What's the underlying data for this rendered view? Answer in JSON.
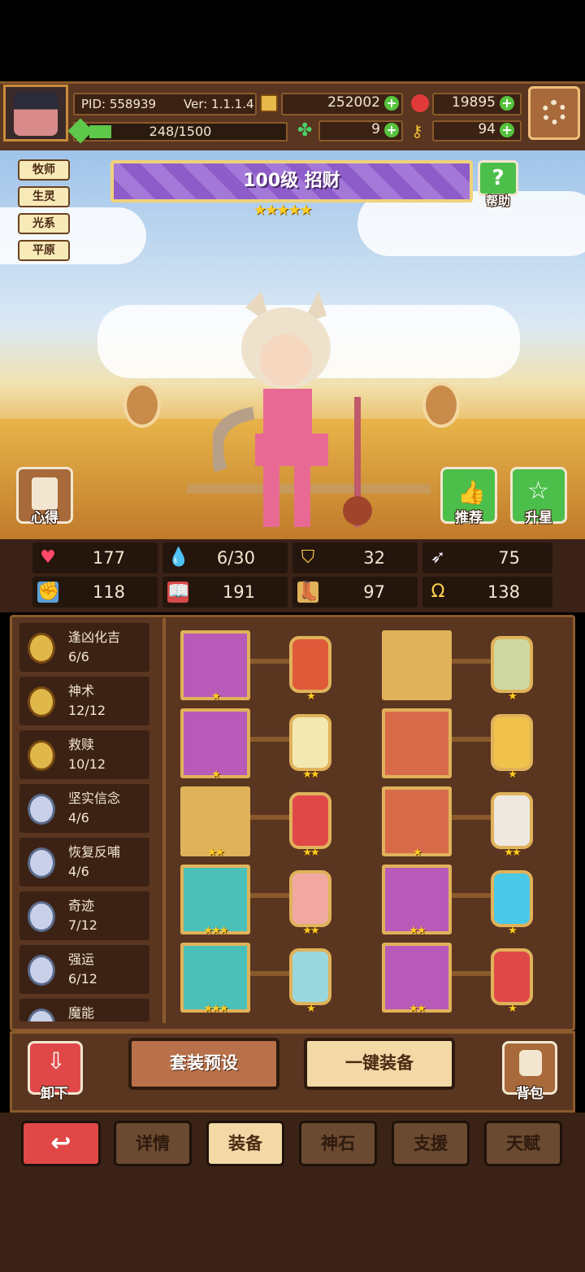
{
  "header": {
    "pid": "PID: 558939",
    "version": "Ver: 1.1.1.4",
    "gold": "252002",
    "ruby": "19895",
    "exp": "248/1500",
    "clover": "9",
    "key": "94"
  },
  "hero": {
    "tags": [
      "牧师",
      "生灵",
      "光系",
      "平原"
    ],
    "title": "100级 招财",
    "stars": "★★★★★",
    "help_label": "帮助",
    "notes_label": "心得",
    "recommend_label": "推荐",
    "upstar_label": "升星"
  },
  "stats": [
    {
      "icon": "heart-icon",
      "value": "177"
    },
    {
      "icon": "mana-drop-icon",
      "value": "6/30"
    },
    {
      "icon": "armor-shield-icon",
      "value": "32"
    },
    {
      "icon": "wing-icon",
      "value": "75"
    },
    {
      "icon": "fist-icon",
      "value": "118"
    },
    {
      "icon": "spellbook-icon",
      "value": "191"
    },
    {
      "icon": "boots-icon",
      "value": "97"
    },
    {
      "icon": "horseshoe-icon",
      "value": "138"
    }
  ],
  "skills": [
    {
      "name": "逢凶化吉",
      "count": "6/6"
    },
    {
      "name": "神术",
      "count": "12/12"
    },
    {
      "name": "救赎",
      "count": "10/12"
    },
    {
      "name": "坚实信念",
      "count": "4/6"
    },
    {
      "name": "恢复反哺",
      "count": "4/6"
    },
    {
      "name": "奇迹",
      "count": "7/12"
    },
    {
      "name": "强运",
      "count": "6/12"
    },
    {
      "name": "魔能",
      "count": ""
    }
  ],
  "equipment": [
    {
      "item": "mace",
      "item_stars": "★",
      "gem": "red-tablet",
      "gem_stars": "★"
    },
    {
      "item": "crown",
      "item_stars": "★",
      "gem": "jade-coin",
      "gem_stars": "★"
    },
    {
      "item": "chestplate",
      "item_stars": "★",
      "gem": "sun-coin",
      "gem_stars": "★★"
    },
    {
      "item": "helmet",
      "item_stars": "★",
      "gem": "sun-coin",
      "gem_stars": "★"
    },
    {
      "item": "necklace",
      "item_stars": "★★",
      "gem": "ruby-gem",
      "gem_stars": "★★"
    },
    {
      "item": "scroll",
      "item_stars": "★",
      "gem": "white-gem",
      "gem_stars": "★★"
    },
    {
      "item": "medal",
      "item_stars": "★★★",
      "gem": "pig-gem",
      "gem_stars": "★★"
    },
    {
      "item": "ring",
      "item_stars": "★★",
      "gem": "aqua-gem",
      "gem_stars": "★"
    },
    {
      "item": "urn",
      "item_stars": "★★★",
      "gem": "ghost-gem",
      "gem_stars": "★"
    },
    {
      "item": "gauntlet",
      "item_stars": "★★",
      "gem": "red-gem",
      "gem_stars": "★"
    }
  ],
  "actions": {
    "unequip": "卸下",
    "preset": "套装预设",
    "equip_all": "一键装备",
    "bag": "背包"
  },
  "tabs": [
    "详情",
    "装备",
    "神石",
    "支援",
    "天赋"
  ],
  "colors": {
    "gold_plus": "#55c23c",
    "banner": "#8e5cc8",
    "active_tab": "#f3d9a6",
    "back_button": "#e04848"
  }
}
